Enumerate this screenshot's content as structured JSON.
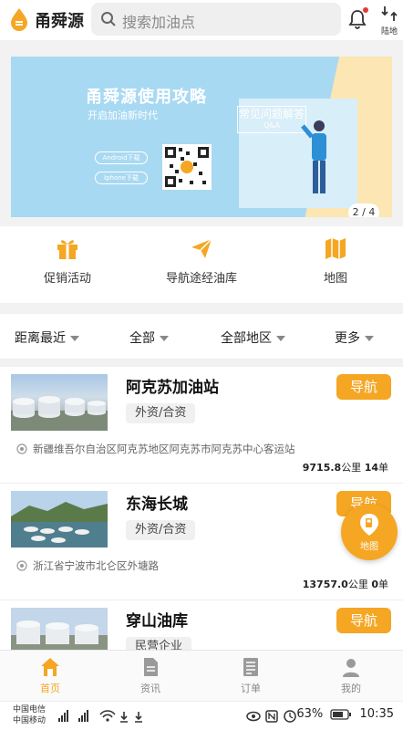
{
  "header": {
    "app_name": "甬舜源",
    "search_placeholder": "搜索加油点",
    "locate_label": "陆地"
  },
  "banner": {
    "title": "甬舜源使用攻略",
    "subtitle": "开启加油新时代",
    "android_label": "Android下载",
    "iphone_label": "Iphone下载",
    "qa_title": "常见问题解答",
    "qa_sub": "Q&A",
    "indicator": "2 / 4"
  },
  "quick_links": [
    {
      "label": "促销活动",
      "icon": "gift-icon"
    },
    {
      "label": "导航途经油库",
      "icon": "paper-plane-icon"
    },
    {
      "label": "地图",
      "icon": "map-icon"
    }
  ],
  "filters": {
    "distance": "距离最近",
    "type": "全部",
    "region": "全部地区",
    "more": "更多"
  },
  "stations": [
    {
      "name": "阿克苏加油站",
      "tag": "外资/合资",
      "nav_label": "导航",
      "address": "新疆维吾尔自治区阿克苏地区阿克苏市阿克苏中心客运站",
      "distance": "9715.8",
      "distance_unit": "公里",
      "orders": "14",
      "orders_unit": "单"
    },
    {
      "name": "东海长城",
      "tag": "外资/合资",
      "nav_label": "导航",
      "address": "浙江省宁波市北仑区外塘路",
      "distance": "13757.0",
      "distance_unit": "公里",
      "orders": "0",
      "orders_unit": "单"
    },
    {
      "name": "穿山油库",
      "tag": "民营企业",
      "nav_label": "导航",
      "address": "",
      "distance": "",
      "distance_unit": "",
      "orders": "",
      "orders_unit": ""
    }
  ],
  "float_button": {
    "label": "地图"
  },
  "tabs": [
    {
      "label": "首页",
      "icon": "home-icon",
      "active": true
    },
    {
      "label": "资讯",
      "icon": "document-icon",
      "active": false
    },
    {
      "label": "订单",
      "icon": "orders-icon",
      "active": false
    },
    {
      "label": "我的",
      "icon": "user-icon",
      "active": false
    }
  ],
  "status_bar": {
    "carrier_1": "中国电信",
    "carrier_2": "中国移动",
    "battery": "63%",
    "time": "10:35"
  },
  "colors": {
    "accent": "#f5a623",
    "banner_blue": "#a8d9f2",
    "banner_yellow": "#fce6b3"
  }
}
